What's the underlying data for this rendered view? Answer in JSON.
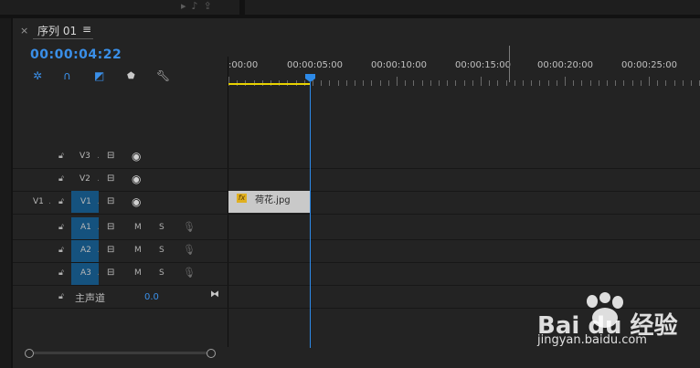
{
  "sequence": {
    "close_icon": "×",
    "title": "序列 01",
    "menu_icon": "≡",
    "timecode": "00:00:04:22"
  },
  "toolbar": {
    "tools": [
      "snap-icon",
      "linked-selection-icon",
      "add-marker-menu-icon",
      "marker-icon",
      "wrench-icon"
    ]
  },
  "ruler": {
    "tick_labels": [
      ":00:00",
      "00:00:05:00",
      "00:00:10:00",
      "00:00:15:00",
      "00:00:20:00",
      "00:00:25:00"
    ]
  },
  "tracks": {
    "video": [
      {
        "label": "V3",
        "source": ""
      },
      {
        "label": "V2",
        "source": ""
      },
      {
        "label": "V1",
        "source": "V1"
      }
    ],
    "audio": [
      {
        "label": "A1",
        "m": "M",
        "s": "S"
      },
      {
        "label": "A2",
        "m": "M",
        "s": "S"
      },
      {
        "label": "A3",
        "m": "M",
        "s": "S"
      }
    ],
    "master": {
      "label": "主声道",
      "value": "0.0"
    }
  },
  "clip": {
    "fx": "fx",
    "name": "荷花.jpg"
  },
  "watermark": {
    "logo": "Bai du 经验",
    "url": "jingyan.baidu.com"
  },
  "colors": {
    "accent": "#3a8fe8",
    "active_track": "#15527e",
    "work_area": "#e8d200",
    "clip": "#c9c9c9"
  }
}
